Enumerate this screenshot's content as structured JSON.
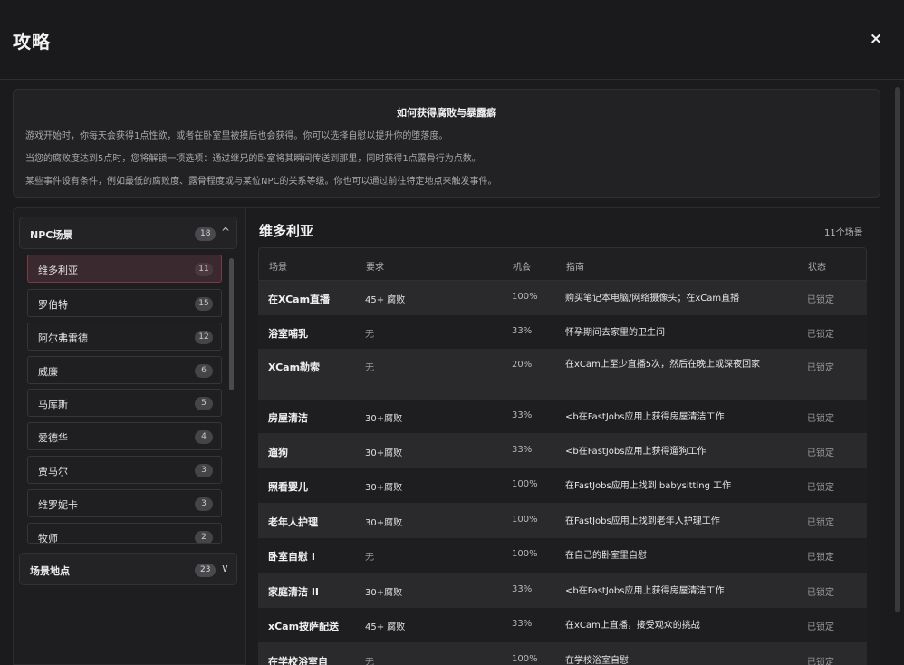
{
  "modal": {
    "title": "攻略",
    "close_icon": "×"
  },
  "guide": {
    "title": "如何获得腐败与暴露癖",
    "lines": [
      "游戏开始时，你每天会获得1点性欲，或者在卧室里被摸后也会获得。你可以选择自慰以提升你的堕落度。",
      "当您的腐败度达到5点时，您将解锁一项选项：通过继兄的卧室将其瞬间传送到那里，同时获得1点露骨行为点数。",
      "某些事件设有条件，例如最低的腐败度、露骨程度或与某位NPC的关系等级。你也可以通过前往特定地点来触发事件。"
    ]
  },
  "sidebar": {
    "npc_section": {
      "label": "NPC场景",
      "count": "18",
      "chevron": "^"
    },
    "npcs": [
      {
        "name": "维多利亚",
        "count": "11",
        "active": true
      },
      {
        "name": "罗伯特",
        "count": "15"
      },
      {
        "name": "阿尔弗雷德",
        "count": "12"
      },
      {
        "name": "威廉",
        "count": "6"
      },
      {
        "name": "马库斯",
        "count": "5"
      },
      {
        "name": "爱德华",
        "count": "4"
      },
      {
        "name": "贾马尔",
        "count": "3"
      },
      {
        "name": "维罗妮卡",
        "count": "3"
      },
      {
        "name": "牧师",
        "count": "2"
      }
    ],
    "location_section": {
      "label": "场景地点",
      "count": "23",
      "chevron": "∨"
    }
  },
  "main": {
    "scene_title": "维多利亚",
    "scene_count": "11个场景",
    "headers": [
      "场景",
      "要求",
      "机会",
      "指南",
      "状态"
    ],
    "rows": [
      {
        "scene": "在XCam直播",
        "requirement": "45+ 腐败",
        "chance": "100%",
        "guide": "购买笔记本电脑/网络摄像头；在xCam直播",
        "status": "已锁定"
      },
      {
        "scene": "浴室哺乳",
        "requirement": "无",
        "chance": "33%",
        "guide": "怀孕期间去家里的卫生间",
        "status": "已锁定"
      },
      {
        "scene": "XCam勒索",
        "requirement": "无",
        "chance": "20%",
        "guide": "在xCam上至少直播5次，然后在晚上或深夜回家",
        "status": "已锁定"
      },
      {
        "scene": "房屋清洁",
        "requirement": "30+腐败",
        "chance": "33%",
        "guide": "<b在FastJobs应用上获得房屋清洁工作",
        "status": "已锁定"
      },
      {
        "scene": "遛狗",
        "requirement": "30+腐败",
        "chance": "33%",
        "guide": "<b在FastJobs应用上获得遛狗工作",
        "status": "已锁定"
      },
      {
        "scene": "照看婴儿",
        "requirement": "30+腐败",
        "chance": "100%",
        "guide": "在FastJobs应用上找到 babysitting 工作",
        "status": "已锁定"
      },
      {
        "scene": "老年人护理",
        "requirement": "30+腐败",
        "chance": "100%",
        "guide": "在FastJobs应用上找到老年人护理工作",
        "status": "已锁定"
      },
      {
        "scene": "卧室自慰 I",
        "requirement": "无",
        "chance": "100%",
        "guide": "在自己的卧室里自慰",
        "status": "已锁定"
      },
      {
        "scene": "家庭清洁 II",
        "requirement": "30+腐败",
        "chance": "33%",
        "guide": "<b在FastJobs应用上获得房屋清洁工作",
        "status": "已锁定"
      },
      {
        "scene": "xCam披萨配送",
        "requirement": "45+ 腐败",
        "chance": "33%",
        "guide": "在xCam上直播，接受观众的挑战",
        "status": "已锁定"
      },
      {
        "scene": "在学校浴室自",
        "requirement": "无",
        "chance": "100%",
        "guide": "在学校浴室自慰",
        "status": "已锁定"
      }
    ]
  }
}
